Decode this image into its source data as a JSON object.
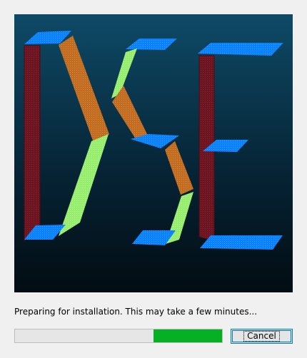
{
  "banner": {
    "logo_text": "DSE",
    "colors": {
      "background_top": "#0e4a66",
      "background_bottom": "#020c12",
      "top_face": "#0a82ff",
      "red_bar": "#6b1520",
      "orange_bar": "#c06c22",
      "green_bar": "#96ed6e"
    }
  },
  "status": {
    "message": "Preparing for installation. This may take a few minutes..."
  },
  "progress": {
    "mode": "marquee",
    "segment_start_fraction": 0.67,
    "segment_end_fraction": 1.0,
    "fill_color": "#06b025"
  },
  "cancel_button": {
    "label": "Cancel"
  }
}
